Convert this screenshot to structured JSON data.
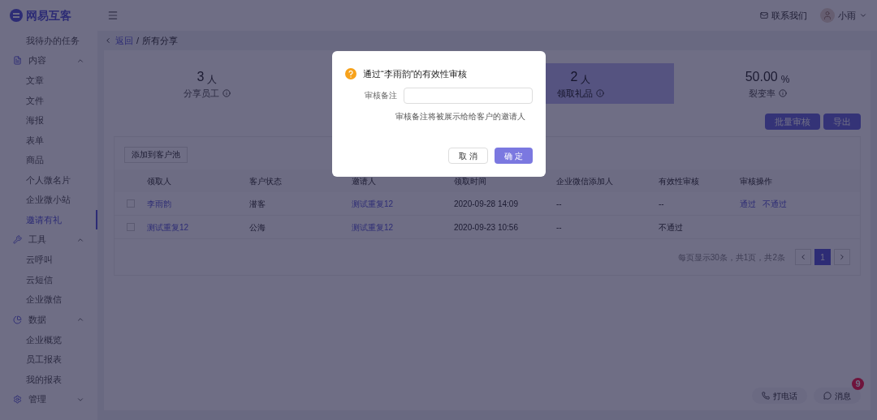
{
  "brand": "网易互客",
  "sidebar": {
    "top_item": {
      "label": "我待办的任务",
      "selected": false
    },
    "groups": [
      {
        "label": "内容",
        "kind": "doc",
        "expanded": true,
        "items": [
          {
            "label": "文章",
            "selected": false
          },
          {
            "label": "文件",
            "selected": false
          },
          {
            "label": "海报",
            "selected": false
          },
          {
            "label": "表单",
            "selected": false
          },
          {
            "label": "商品",
            "selected": false
          },
          {
            "label": "个人微名片",
            "selected": false
          },
          {
            "label": "企业微小站",
            "selected": false
          },
          {
            "label": "邀请有礼",
            "selected": true
          }
        ]
      },
      {
        "label": "工具",
        "kind": "tool",
        "expanded": true,
        "items": [
          {
            "label": "云呼叫",
            "selected": false
          },
          {
            "label": "云短信",
            "selected": false
          },
          {
            "label": "企业微信",
            "selected": false
          }
        ]
      },
      {
        "label": "数据",
        "kind": "chart",
        "expanded": true,
        "items": [
          {
            "label": "企业概览",
            "selected": false
          },
          {
            "label": "员工报表",
            "selected": false
          },
          {
            "label": "我的报表",
            "selected": false
          }
        ]
      },
      {
        "label": "管理",
        "kind": "gear",
        "expanded": false
      }
    ]
  },
  "header": {
    "contact": "联系我们",
    "user": "小雨"
  },
  "breadcrumb": {
    "back": "返回",
    "separator": "/",
    "current": "所有分享"
  },
  "stats": [
    {
      "value": "3",
      "unit": "人",
      "label": "分享员工",
      "selected": false
    },
    {
      "value": "2",
      "unit": "人",
      "label": "领取礼品",
      "selected": true
    },
    {
      "value": "50.00",
      "unit": "%",
      "label": "裂变率",
      "selected": false
    }
  ],
  "actions": [
    "批量审核",
    "导出"
  ],
  "table_tab": "添加到客户池",
  "table": {
    "columns": [
      "领取人",
      "客户状态",
      "邀请人",
      "领取时间",
      "企业微信添加人",
      "有效性审核",
      "审核操作"
    ],
    "rows": [
      {
        "checked": false,
        "cells": [
          "李雨韵",
          "潜客",
          "测试重复12",
          "2020-09-28 14:09",
          "--",
          "--"
        ],
        "operations": [
          "通过",
          "不通过"
        ]
      },
      {
        "checked": false,
        "cells": [
          "测试重复12",
          "公海",
          "测试重复12",
          "2020-09-23 10:56",
          "--",
          "不通过"
        ],
        "operations": []
      }
    ]
  },
  "pagination": {
    "summary": "每页显示30条，共1页，共2条",
    "pages": [
      {
        "label": "1",
        "selected": true
      }
    ]
  },
  "float_buttons": {
    "call": "打电话",
    "message": "消息",
    "badge": "9"
  },
  "dialog": {
    "title": "通过“李雨韵”的有效性审核",
    "field_label": "审核备注",
    "hint": "审核备注将被展示给给客户的邀请人",
    "cancel": "取 消",
    "ok": "确 定"
  }
}
